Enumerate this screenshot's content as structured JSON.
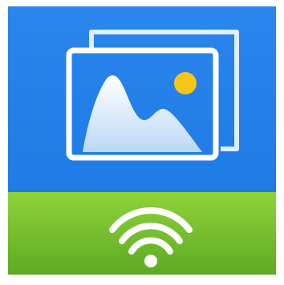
{
  "app_icon": {
    "icon_name": "photo-wifi-transfer-icon",
    "colors": {
      "sky_top": "#2a86ec",
      "sky_bottom": "#1f7be5",
      "grass_top": "#8fd33b",
      "grass_bottom": "#5eaa22",
      "frame": "#ffffff",
      "sun": "#f5c518",
      "wifi": "#ffffff"
    },
    "elements": {
      "background_icon": "photo-stack-icon",
      "front_photo_icon": "image-icon",
      "mountain_icon": "mountain-icon",
      "sun_icon": "sun-icon",
      "wifi_icon": "wifi-icon"
    }
  }
}
